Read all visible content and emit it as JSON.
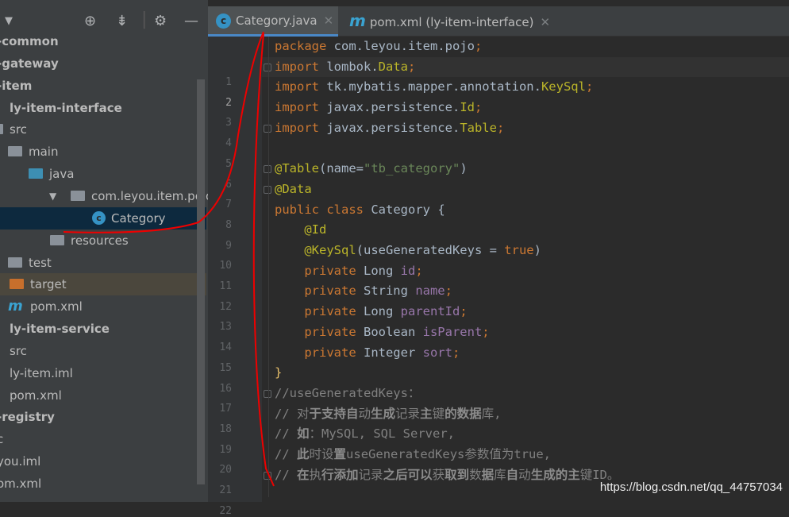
{
  "sidebar": {
    "toolbar_icons": [
      "locate-icon",
      "collapse-icon",
      "gear-icon",
      "minimize-icon"
    ],
    "items": [
      {
        "label": "-common",
        "bold": true
      },
      {
        "label": "-gateway",
        "bold": true
      },
      {
        "label": "-item",
        "bold": true
      },
      {
        "label": "ly-item-interface",
        "bold": true
      },
      {
        "label": "src"
      },
      {
        "label": "main"
      },
      {
        "label": "java"
      },
      {
        "label": "com.leyou.item.pojo"
      },
      {
        "label": "Category",
        "selected": true
      },
      {
        "label": "resources"
      },
      {
        "label": "test"
      },
      {
        "label": "target"
      },
      {
        "label": "pom.xml"
      },
      {
        "label": "ly-item-service",
        "bold": true
      },
      {
        "label": "src"
      },
      {
        "label": "ly-item.iml"
      },
      {
        "label": "pom.xml"
      },
      {
        "label": "-registry",
        "bold": true
      },
      {
        "label": "c"
      },
      {
        "label": "you.iml"
      },
      {
        "label": "om.xml"
      }
    ]
  },
  "tabs": [
    {
      "label": "Category.java",
      "icon": "class-icon",
      "active": true
    },
    {
      "label": "pom.xml (ly-item-interface)",
      "icon": "maven-icon"
    }
  ],
  "editor": {
    "current_line": 2,
    "lines": [
      [
        [
          "package ",
          "kw"
        ],
        [
          "com.leyou.item.pojo",
          ""
        ],
        [
          ";",
          "kw"
        ]
      ],
      [
        [
          "import ",
          "kw"
        ],
        [
          "lombok.",
          ""
        ],
        [
          "Data",
          "an"
        ],
        [
          ";",
          "kw"
        ]
      ],
      [
        [
          "import ",
          "kw"
        ],
        [
          "tk.mybatis.mapper.annotation.",
          ""
        ],
        [
          "KeySql",
          "an"
        ],
        [
          ";",
          "kw"
        ]
      ],
      [
        [
          "import ",
          "kw"
        ],
        [
          "javax.persistence.",
          ""
        ],
        [
          "Id",
          "an"
        ],
        [
          ";",
          "kw"
        ]
      ],
      [
        [
          "import ",
          "kw"
        ],
        [
          "javax.persistence.",
          ""
        ],
        [
          "Table",
          "an"
        ],
        [
          ";",
          "kw"
        ]
      ],
      [],
      [
        [
          "@Table",
          "an"
        ],
        [
          "(name=",
          ""
        ],
        [
          "\"tb_category\"",
          "st"
        ],
        [
          ")",
          ""
        ]
      ],
      [
        [
          "@Data",
          "an"
        ]
      ],
      [
        [
          "public class ",
          "kw"
        ],
        [
          "Category {",
          ""
        ]
      ],
      [
        [
          "    @Id",
          "an"
        ]
      ],
      [
        [
          "    @KeySql",
          "an"
        ],
        [
          "(useGeneratedKeys = ",
          ""
        ],
        [
          "true",
          "kw"
        ],
        [
          ")",
          ""
        ]
      ],
      [
        [
          "    private ",
          "kw"
        ],
        [
          "Long ",
          ""
        ],
        [
          "id",
          "fd"
        ],
        [
          ";",
          "kw"
        ]
      ],
      [
        [
          "    private ",
          "kw"
        ],
        [
          "String ",
          ""
        ],
        [
          "name",
          "fd"
        ],
        [
          ";",
          "kw"
        ]
      ],
      [
        [
          "    private ",
          "kw"
        ],
        [
          "Long ",
          ""
        ],
        [
          "parentId",
          "fd"
        ],
        [
          ";",
          "kw"
        ]
      ],
      [
        [
          "    private ",
          "kw"
        ],
        [
          "Boolean ",
          ""
        ],
        [
          "isParent",
          "fd"
        ],
        [
          ";",
          "kw"
        ]
      ],
      [
        [
          "    private ",
          "kw"
        ],
        [
          "Integer ",
          ""
        ],
        [
          "sort",
          "fd"
        ],
        [
          ";",
          "kw"
        ]
      ],
      [
        [
          "}",
          "br"
        ]
      ],
      [
        [
          "//useGeneratedKeys：",
          "cm"
        ]
      ],
      [
        [
          "// 对",
          "cm"
        ],
        [
          "于支持自",
          "cmb"
        ],
        [
          "动",
          "cm"
        ],
        [
          "生成",
          "cmb"
        ],
        [
          "记录",
          "cm"
        ],
        [
          "主",
          "cmb"
        ],
        [
          "键",
          "cm"
        ],
        [
          "的数据",
          "cmb"
        ],
        [
          "库,",
          "cm"
        ]
      ],
      [
        [
          "// ",
          "cm"
        ],
        [
          "如",
          "cmb"
        ],
        [
          "：MySQL, SQL Server,",
          "cm"
        ]
      ],
      [
        [
          "// ",
          "cm"
        ],
        [
          "此",
          "cmb"
        ],
        [
          "时设",
          "cm"
        ],
        [
          "置",
          "cmb"
        ],
        [
          "useGeneratedKeys参数值为true,",
          "cm"
        ]
      ],
      [
        [
          "// ",
          "cm"
        ],
        [
          "在",
          "cmb"
        ],
        [
          "执",
          "cm"
        ],
        [
          "行添加",
          "cmb"
        ],
        [
          "记录",
          "cm"
        ],
        [
          "之后可以",
          "cmb"
        ],
        [
          "获",
          "cm"
        ],
        [
          "取到",
          "cmb"
        ],
        [
          "数",
          "cm"
        ],
        [
          "据",
          "cmb"
        ],
        [
          "库",
          "cm"
        ],
        [
          "自",
          "cmb"
        ],
        [
          "动",
          "cm"
        ],
        [
          "生成的主",
          "cmb"
        ],
        [
          "键ID。",
          "cm"
        ]
      ]
    ]
  },
  "watermark": "https://blog.csdn.net/qq_44757034",
  "colors": {
    "keyword": "#cc7832",
    "annotation": "#bbb529",
    "string": "#6a8759",
    "field": "#9876aa",
    "comment": "#808080",
    "selection": "#0d293e",
    "tab_underline": "#4a88c7"
  }
}
